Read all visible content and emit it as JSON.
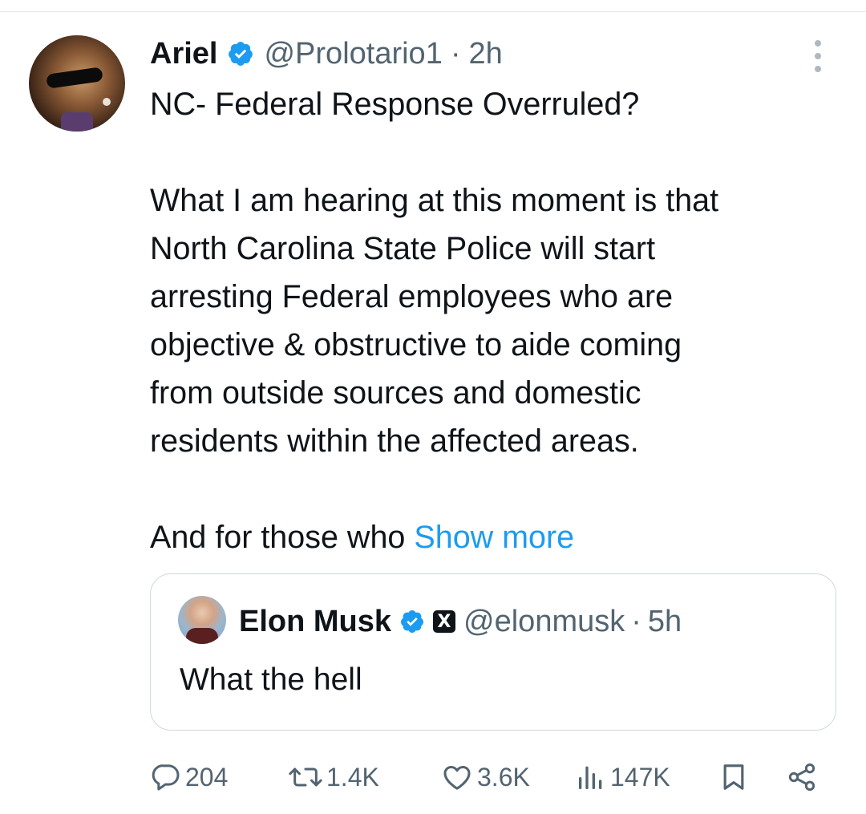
{
  "post": {
    "author_name": "Ariel",
    "handle": "@Prolotario1",
    "separator": "·",
    "time": "2h",
    "text_lines": [
      "NC- Federal Response Overruled?",
      "",
      "What I am hearing at this moment is that",
      "North Carolina State Police will start",
      "arresting Federal employees who are",
      "objective & obstructive to aide coming",
      "from outside sources and domestic",
      "residents within the affected areas.",
      ""
    ],
    "last_line_text": "And for those who ",
    "show_more_label": "Show more"
  },
  "quote": {
    "author_name": "Elon Musk",
    "badge_label": "X",
    "handle": "@elonmusk",
    "separator": "·",
    "time": "5h",
    "text": "What the hell"
  },
  "actions": {
    "replies": "204",
    "reposts": "1.4K",
    "likes": "3.6K",
    "views": "147K"
  },
  "colors": {
    "accent": "#1d9bf0",
    "secondary_text": "#536471",
    "border": "#cfd9de"
  },
  "icons": {
    "verified": "verified-badge-icon",
    "more": "more-options-icon",
    "reply": "reply-icon",
    "repost": "repost-icon",
    "like": "heart-icon",
    "views": "views-chart-icon",
    "bookmark": "bookmark-icon",
    "share": "share-icon"
  }
}
